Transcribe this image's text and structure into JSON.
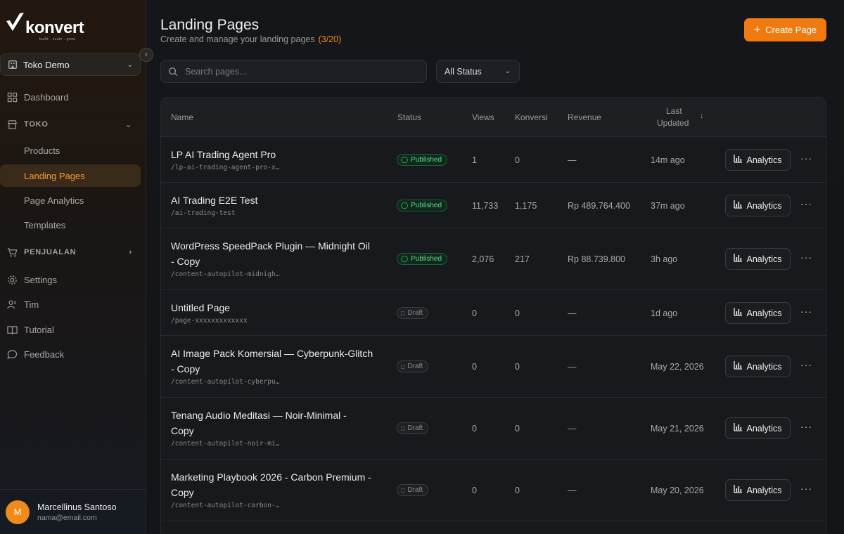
{
  "brand": {
    "name": "konvert",
    "tagline": "build . scale . grow"
  },
  "store": {
    "name": "Toko Demo"
  },
  "nav": {
    "dashboard": "Dashboard",
    "toko_section": "TOKO",
    "products": "Products",
    "landing_pages": "Landing Pages",
    "page_analytics": "Page Analytics",
    "templates": "Templates",
    "penjualan_section": "PENJUALAN",
    "settings": "Settings",
    "tim": "Tim",
    "tutorial": "Tutorial",
    "feedback": "Feedback"
  },
  "user": {
    "initial": "M",
    "name": "Marcellinus Santoso",
    "email": "nama@email.com"
  },
  "header": {
    "title": "Landing Pages",
    "subtitle": "Create and manage your landing pages",
    "count": "(3/20)",
    "create_label": "Create Page"
  },
  "search": {
    "placeholder": "Search pages..."
  },
  "filter": {
    "status": "All Status"
  },
  "table": {
    "columns": {
      "name": "Name",
      "status": "Status",
      "views": "Views",
      "konversi": "Konversi",
      "revenue": "Revenue",
      "last_updated_1": "Last",
      "last_updated_2": "Updated"
    },
    "analytics_label": "Analytics",
    "more_label": "···",
    "rows": [
      {
        "name1": "LP AI Trading Agent Pro",
        "name2": "",
        "slug": "/lp-ai-trading-agent-pro-x…",
        "status": "Published",
        "views": "1",
        "konversi": "0",
        "revenue": "—",
        "updated": "14m ago"
      },
      {
        "name1": "AI Trading E2E Test",
        "name2": "",
        "slug": "/ai-trading-test",
        "status": "Published",
        "views": "11,733",
        "konversi": "1,175",
        "revenue": "Rp 489.764.400",
        "updated": "37m ago"
      },
      {
        "name1": "WordPress SpeedPack Plugin — Midnight Oil",
        "name2": "- Copy",
        "slug": "/content-autopilot-midnigh…",
        "status": "Published",
        "views": "2,076",
        "konversi": "217",
        "revenue": "Rp 88.739.800",
        "updated": "3h ago"
      },
      {
        "name1": "Untitled Page",
        "name2": "",
        "slug": "/page-xxxxxxxxxxxxx",
        "status": "Draft",
        "views": "0",
        "konversi": "0",
        "revenue": "—",
        "updated": "1d ago"
      },
      {
        "name1": "AI Image Pack Komersial — Cyberpunk-Glitch",
        "name2": "- Copy",
        "slug": "/content-autopilot-cyberpu…",
        "status": "Draft",
        "views": "0",
        "konversi": "0",
        "revenue": "—",
        "updated": "May 22, 2026"
      },
      {
        "name1": "Tenang Audio Meditasi — Noir-Minimal -",
        "name2": "Copy",
        "slug": "/content-autopilot-noir-mi…",
        "status": "Draft",
        "views": "0",
        "konversi": "0",
        "revenue": "—",
        "updated": "May 21, 2026"
      },
      {
        "name1": "Marketing Playbook 2026 - Carbon Premium -",
        "name2": "Copy",
        "slug": "/content-autopilot-carbon-…",
        "status": "Draft",
        "views": "0",
        "konversi": "0",
        "revenue": "—",
        "updated": "May 20, 2026"
      }
    ]
  },
  "colors": {
    "accent": "#f07a10",
    "published": "#5fd78e",
    "active_nav_bg": "#3a2a1a"
  }
}
